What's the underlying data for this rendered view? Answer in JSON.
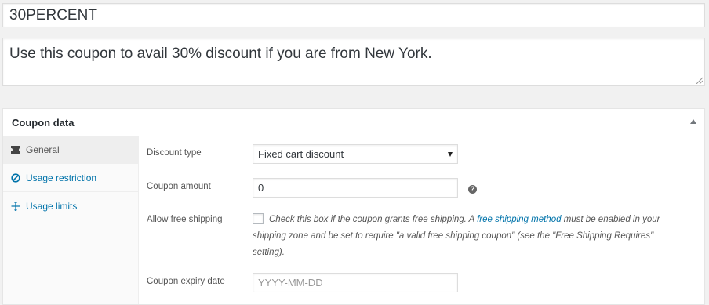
{
  "coupon": {
    "code": "30PERCENT",
    "description": "Use this coupon to avail 30% discount if you are from New York."
  },
  "panel": {
    "title": "Coupon data"
  },
  "tabs": [
    {
      "label": "General",
      "icon": "ticket-icon"
    },
    {
      "label": "Usage restriction",
      "icon": "ban-icon"
    },
    {
      "label": "Usage limits",
      "icon": "limits-icon"
    }
  ],
  "general": {
    "discount_type_label": "Discount type",
    "discount_type_value": "Fixed cart discount",
    "coupon_amount_label": "Coupon amount",
    "coupon_amount_value": "0",
    "free_shipping_label": "Allow free shipping",
    "free_shipping_text_before": "Check this box if the coupon grants free shipping. A ",
    "free_shipping_link": "free shipping method",
    "free_shipping_text_after": " must be enabled in your shipping zone and be set to require \"a valid free shipping coupon\" (see the \"Free Shipping Requires\" setting).",
    "expiry_label": "Coupon expiry date",
    "expiry_placeholder": "YYYY-MM-DD"
  },
  "colors": {
    "link": "#0073aa",
    "tab_active_bg": "#eeeeee",
    "tabs_bg": "#fafafa"
  }
}
